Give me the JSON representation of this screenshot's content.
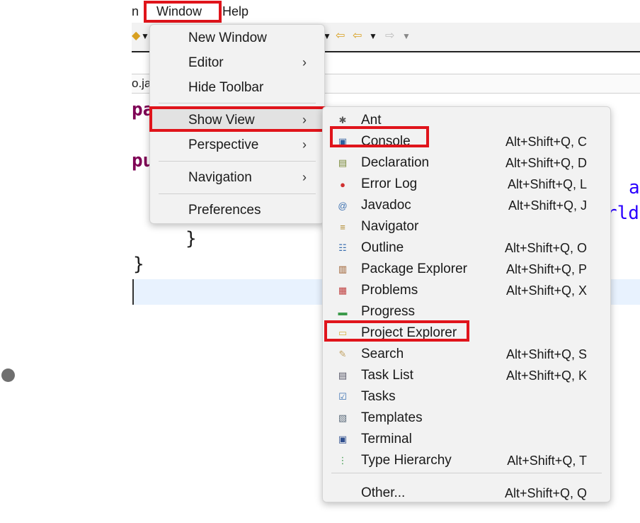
{
  "menubar": {
    "items": [
      "n",
      "Window",
      "Help"
    ]
  },
  "editor": {
    "tab_label": "o.ja",
    "code_fragments": [
      "pa",
      "pu",
      "}",
      "}",
      "a",
      "rld"
    ]
  },
  "window_menu": {
    "items": [
      {
        "label": "New Window",
        "submenu": false
      },
      {
        "label": "Editor",
        "submenu": true
      },
      {
        "label": "Hide Toolbar",
        "submenu": false
      },
      {
        "label": "Show View",
        "submenu": true,
        "selected": true
      },
      {
        "label": "Perspective",
        "submenu": true
      },
      {
        "label": "Navigation",
        "submenu": true
      },
      {
        "label": "Preferences",
        "submenu": false
      }
    ]
  },
  "show_view_menu": {
    "items": [
      {
        "label": "Ant",
        "shortcut": "",
        "icon": "ant-icon",
        "color": "#5a5a5a"
      },
      {
        "label": "Console",
        "shortcut": "Alt+Shift+Q, C",
        "icon": "console-icon",
        "color": "#2f5f9e"
      },
      {
        "label": "Declaration",
        "shortcut": "Alt+Shift+Q, D",
        "icon": "declaration-icon",
        "color": "#7a8a3a"
      },
      {
        "label": "Error Log",
        "shortcut": "Alt+Shift+Q, L",
        "icon": "error-log-icon",
        "color": "#d03030"
      },
      {
        "label": "Javadoc",
        "shortcut": "Alt+Shift+Q, J",
        "icon": "javadoc-icon",
        "color": "#3a6fb0"
      },
      {
        "label": "Navigator",
        "shortcut": "",
        "icon": "navigator-icon",
        "color": "#b08a30"
      },
      {
        "label": "Outline",
        "shortcut": "Alt+Shift+Q, O",
        "icon": "outline-icon",
        "color": "#3a6fb0"
      },
      {
        "label": "Package Explorer",
        "shortcut": "Alt+Shift+Q, P",
        "icon": "package-explorer-icon",
        "color": "#9a5a2a"
      },
      {
        "label": "Problems",
        "shortcut": "Alt+Shift+Q, X",
        "icon": "problems-icon",
        "color": "#c04040"
      },
      {
        "label": "Progress",
        "shortcut": "",
        "icon": "progress-icon",
        "color": "#3a9a4a"
      },
      {
        "label": "Project Explorer",
        "shortcut": "",
        "icon": "project-explorer-icon",
        "color": "#d8b040"
      },
      {
        "label": "Search",
        "shortcut": "Alt+Shift+Q, S",
        "icon": "search-icon",
        "color": "#c0a060"
      },
      {
        "label": "Task List",
        "shortcut": "Alt+Shift+Q, K",
        "icon": "task-list-icon",
        "color": "#555566"
      },
      {
        "label": "Tasks",
        "shortcut": "",
        "icon": "tasks-icon",
        "color": "#3a6fb0"
      },
      {
        "label": "Templates",
        "shortcut": "",
        "icon": "templates-icon",
        "color": "#5a6a7a"
      },
      {
        "label": "Terminal",
        "shortcut": "",
        "icon": "terminal-icon",
        "color": "#2f4f8e"
      },
      {
        "label": "Type Hierarchy",
        "shortcut": "Alt+Shift+Q, T",
        "icon": "type-hierarchy-icon",
        "color": "#3a9a4a"
      },
      {
        "label": "Other...",
        "shortcut": "Alt+Shift+Q, Q",
        "icon": "",
        "color": "#000000"
      }
    ]
  },
  "colors": {
    "highlight_box": "#e0141b",
    "keyword": "#7f0055",
    "string": "#2a00ff"
  }
}
